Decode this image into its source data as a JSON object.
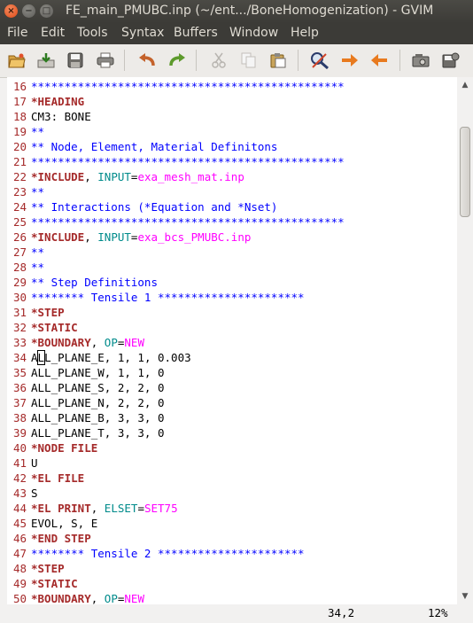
{
  "window": {
    "title": "FE_main_PMUBC.inp (~/ent.../BoneHomogenization) - GVIM",
    "controls": {
      "close": "×",
      "minimize": "−",
      "maximize": "□"
    }
  },
  "menu": [
    "File",
    "Edit",
    "Tools",
    "Syntax",
    "Buffers",
    "Window",
    "Help"
  ],
  "toolbar": {
    "icons": [
      "open-file-icon",
      "save-icon",
      "save-all-icon",
      "print-icon",
      "undo-icon",
      "redo-icon",
      "cut-icon",
      "copy-icon",
      "paste-icon",
      "find-replace-icon",
      "find-next-icon",
      "find-previous-icon",
      "load-session-icon",
      "save-session-icon"
    ]
  },
  "colors": {
    "line_number": "#a52a2a",
    "keyword": "#a52a2a",
    "comment": "#0000ff",
    "param": "#008b8b",
    "value": "#ff00ff",
    "text": "#000000"
  },
  "editor": {
    "cursor": {
      "line": 34,
      "col": 2
    },
    "lines": [
      {
        "num": "16",
        "segs": [
          {
            "t": "***********************************************",
            "c": "comment"
          }
        ]
      },
      {
        "num": "17",
        "segs": [
          {
            "t": "*HEADING",
            "c": "keyword"
          }
        ]
      },
      {
        "num": "18",
        "segs": [
          {
            "t": "CM3: BONE",
            "c": "text"
          }
        ]
      },
      {
        "num": "19",
        "segs": [
          {
            "t": "**",
            "c": "comment"
          }
        ]
      },
      {
        "num": "20",
        "segs": [
          {
            "t": "** Node, Element, Material Definitons",
            "c": "comment"
          }
        ]
      },
      {
        "num": "21",
        "segs": [
          {
            "t": "***********************************************",
            "c": "comment"
          }
        ]
      },
      {
        "num": "22",
        "segs": [
          {
            "t": "*INCLUDE",
            "c": "keyword"
          },
          {
            "t": ", ",
            "c": "text"
          },
          {
            "t": "INPUT",
            "c": "param"
          },
          {
            "t": "=",
            "c": "text"
          },
          {
            "t": "exa_mesh_mat.inp",
            "c": "value"
          }
        ]
      },
      {
        "num": "23",
        "segs": [
          {
            "t": "**",
            "c": "comment"
          }
        ]
      },
      {
        "num": "24",
        "segs": [
          {
            "t": "** Interactions (*Equation and *Nset)",
            "c": "comment"
          }
        ]
      },
      {
        "num": "25",
        "segs": [
          {
            "t": "***********************************************",
            "c": "comment"
          }
        ]
      },
      {
        "num": "26",
        "segs": [
          {
            "t": "*INCLUDE",
            "c": "keyword"
          },
          {
            "t": ", ",
            "c": "text"
          },
          {
            "t": "INPUT",
            "c": "param"
          },
          {
            "t": "=",
            "c": "text"
          },
          {
            "t": "exa_bcs_PMUBC.inp",
            "c": "value"
          }
        ]
      },
      {
        "num": "27",
        "segs": [
          {
            "t": "**",
            "c": "comment"
          }
        ]
      },
      {
        "num": "28",
        "segs": [
          {
            "t": "**",
            "c": "comment"
          }
        ]
      },
      {
        "num": "29",
        "segs": [
          {
            "t": "** Step Definitions",
            "c": "comment"
          }
        ]
      },
      {
        "num": "30",
        "segs": [
          {
            "t": "******** Tensile 1 **********************",
            "c": "comment"
          }
        ]
      },
      {
        "num": "31",
        "segs": [
          {
            "t": "*STEP",
            "c": "keyword"
          }
        ]
      },
      {
        "num": "32",
        "segs": [
          {
            "t": "*STATIC",
            "c": "keyword"
          }
        ]
      },
      {
        "num": "33",
        "segs": [
          {
            "t": "*BOUNDARY",
            "c": "keyword"
          },
          {
            "t": ", ",
            "c": "text"
          },
          {
            "t": "OP",
            "c": "param"
          },
          {
            "t": "=",
            "c": "text"
          },
          {
            "t": "NEW",
            "c": "value"
          }
        ]
      },
      {
        "num": "34",
        "segs": [
          {
            "t": "A",
            "c": "text"
          },
          {
            "t": "L",
            "c": "cursor"
          },
          {
            "t": "L_PLANE_E, 1, 1, 0.003",
            "c": "text"
          }
        ]
      },
      {
        "num": "35",
        "segs": [
          {
            "t": "ALL_PLANE_W, 1, 1, 0",
            "c": "text"
          }
        ]
      },
      {
        "num": "36",
        "segs": [
          {
            "t": "ALL_PLANE_S, 2, 2, 0",
            "c": "text"
          }
        ]
      },
      {
        "num": "37",
        "segs": [
          {
            "t": "ALL_PLANE_N, 2, 2, 0",
            "c": "text"
          }
        ]
      },
      {
        "num": "38",
        "segs": [
          {
            "t": "ALL_PLANE_B, 3, 3, 0",
            "c": "text"
          }
        ]
      },
      {
        "num": "39",
        "segs": [
          {
            "t": "ALL_PLANE_T, 3, 3, 0",
            "c": "text"
          }
        ]
      },
      {
        "num": "40",
        "segs": [
          {
            "t": "*NODE FILE",
            "c": "keyword"
          }
        ]
      },
      {
        "num": "41",
        "segs": [
          {
            "t": "U",
            "c": "text"
          }
        ]
      },
      {
        "num": "42",
        "segs": [
          {
            "t": "*EL FILE",
            "c": "keyword"
          }
        ]
      },
      {
        "num": "43",
        "segs": [
          {
            "t": "S",
            "c": "text"
          }
        ]
      },
      {
        "num": "44",
        "segs": [
          {
            "t": "*EL PRINT",
            "c": "keyword"
          },
          {
            "t": ", ",
            "c": "text"
          },
          {
            "t": "ELSET",
            "c": "param"
          },
          {
            "t": "=",
            "c": "text"
          },
          {
            "t": "SET75",
            "c": "value"
          }
        ]
      },
      {
        "num": "45",
        "segs": [
          {
            "t": "EVOL, S, E",
            "c": "text"
          }
        ]
      },
      {
        "num": "46",
        "segs": [
          {
            "t": "*END STEP",
            "c": "keyword"
          }
        ]
      },
      {
        "num": "47",
        "segs": [
          {
            "t": "******** Tensile 2 **********************",
            "c": "comment"
          }
        ]
      },
      {
        "num": "48",
        "segs": [
          {
            "t": "*STEP",
            "c": "keyword"
          }
        ]
      },
      {
        "num": "49",
        "segs": [
          {
            "t": "*STATIC",
            "c": "keyword"
          }
        ]
      },
      {
        "num": "50",
        "segs": [
          {
            "t": "*BOUNDARY",
            "c": "keyword"
          },
          {
            "t": ", ",
            "c": "text"
          },
          {
            "t": "OP",
            "c": "param"
          },
          {
            "t": "=",
            "c": "text"
          },
          {
            "t": "NEW",
            "c": "value"
          }
        ]
      }
    ]
  },
  "status": {
    "position": "34,2",
    "percent": "12%"
  },
  "scrollbar": {
    "up": "▲",
    "down": "▼"
  }
}
